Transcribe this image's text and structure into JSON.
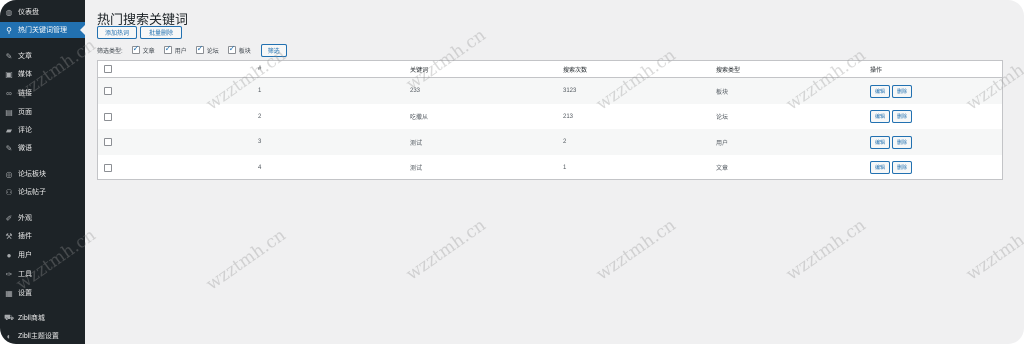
{
  "sidebar": {
    "items": [
      {
        "icon": "dashboard-icon",
        "glyph": "◍",
        "label": "仪表盘"
      },
      {
        "icon": "search-icon",
        "glyph": "⚲",
        "label": "热门关键词管理",
        "active": true
      },
      {
        "icon": "pin-icon",
        "glyph": "✎",
        "label": "文章"
      },
      {
        "icon": "media-icon",
        "glyph": "▣",
        "label": "媒体"
      },
      {
        "icon": "link-icon",
        "glyph": "∞",
        "label": "链接"
      },
      {
        "icon": "page-icon",
        "glyph": "▤",
        "label": "页面"
      },
      {
        "icon": "comment-icon",
        "glyph": "▰",
        "label": "评论"
      },
      {
        "icon": "pin-icon",
        "glyph": "✎",
        "label": "微语"
      },
      {
        "icon": "forum-icon",
        "glyph": "◎",
        "label": "论坛板块"
      },
      {
        "icon": "users-icon",
        "glyph": "⚇",
        "label": "论坛帖子"
      },
      {
        "icon": "appearance-icon",
        "glyph": "✐",
        "label": "外观"
      },
      {
        "icon": "plugin-icon",
        "glyph": "⚒",
        "label": "插件"
      },
      {
        "icon": "user-icon",
        "glyph": "●",
        "label": "用户"
      },
      {
        "icon": "tools-icon",
        "glyph": "✑",
        "label": "工具"
      },
      {
        "icon": "settings-icon",
        "glyph": "▦",
        "label": "设置"
      },
      {
        "icon": "cart-icon",
        "glyph": "⛟",
        "label": "Zibll商城"
      },
      {
        "icon": "theme-icon",
        "glyph": "◐",
        "label": "Zibll主题设置"
      }
    ]
  },
  "page": {
    "title": "热门搜索关键词",
    "add_button": "添加热词",
    "bulk_delete_button": "批量删除",
    "filter_label": "筛选类型:",
    "filter_options": [
      {
        "label": "文章",
        "checked": true
      },
      {
        "label": "用户",
        "checked": true
      },
      {
        "label": "论坛",
        "checked": true
      },
      {
        "label": "板块",
        "checked": true
      }
    ],
    "filter_button": "筛选"
  },
  "table": {
    "headers": [
      "#",
      "关键词",
      "搜索次数",
      "搜索类型",
      "操作"
    ],
    "rows": [
      {
        "id": "1",
        "keyword": "233",
        "count": "3123",
        "type": "板块"
      },
      {
        "id": "2",
        "keyword": "吃撒从",
        "count": "213",
        "type": "论坛"
      },
      {
        "id": "3",
        "keyword": "测试",
        "count": "2",
        "type": "用户"
      },
      {
        "id": "4",
        "keyword": "测试",
        "count": "1",
        "type": "文章"
      }
    ],
    "edit_label": "编辑",
    "delete_label": "删除"
  },
  "watermark": "wzztmh.cn",
  "colors": {
    "sidebar_bg": "#1d2327",
    "accent": "#2271b1",
    "page_bg": "#f0f0f1"
  }
}
